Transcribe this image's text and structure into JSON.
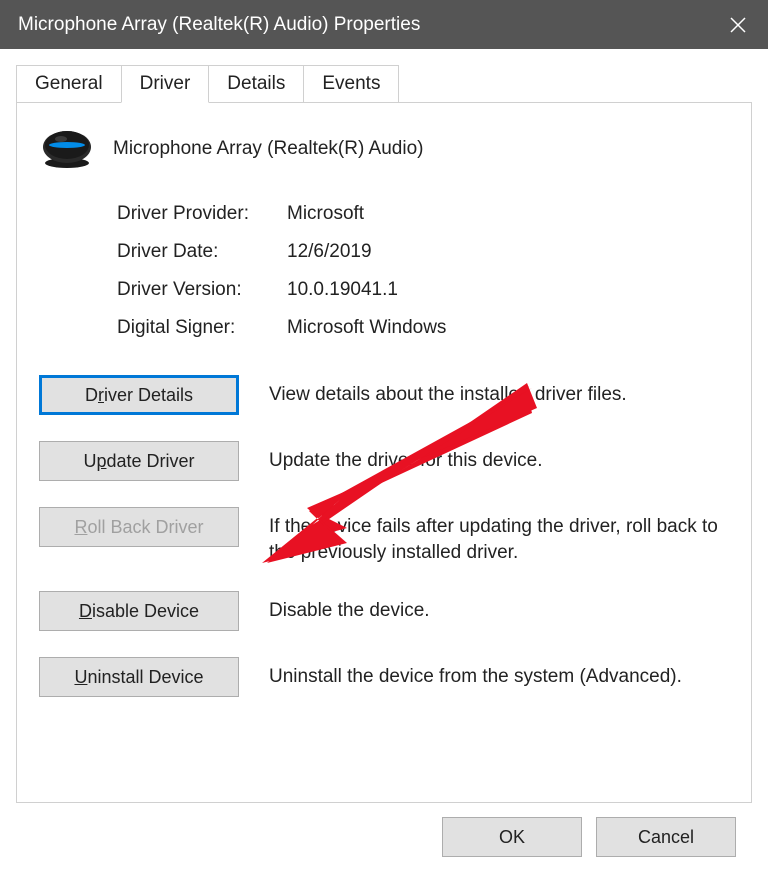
{
  "titlebar": {
    "text": "Microphone Array (Realtek(R) Audio) Properties"
  },
  "tabs": {
    "general": "General",
    "driver": "Driver",
    "details": "Details",
    "events": "Events"
  },
  "device": {
    "name": "Microphone Array (Realtek(R) Audio)"
  },
  "info": {
    "provider_label": "Driver Provider:",
    "provider_value": "Microsoft",
    "date_label": "Driver Date:",
    "date_value": "12/6/2019",
    "version_label": "Driver Version:",
    "version_value": "10.0.19041.1",
    "signer_label": "Digital Signer:",
    "signer_value": "Microsoft Windows"
  },
  "actions": {
    "details_label_pre": "D",
    "details_label_u": "r",
    "details_label_post": "iver Details",
    "details_desc": "View details about the installed driver files.",
    "update_label_pre": "U",
    "update_label_u": "p",
    "update_label_post": "date Driver",
    "update_desc": "Update the driver for this device.",
    "rollback_label_pre": "",
    "rollback_label_u": "R",
    "rollback_label_post": "oll Back Driver",
    "rollback_desc": "If the device fails after updating the driver, roll back to the previously installed driver.",
    "disable_label_pre": "",
    "disable_label_u": "D",
    "disable_label_post": "isable Device",
    "disable_desc": "Disable the device.",
    "uninstall_label_pre": "",
    "uninstall_label_u": "U",
    "uninstall_label_post": "ninstall Device",
    "uninstall_desc": "Uninstall the device from the system (Advanced)."
  },
  "footer": {
    "ok": "OK",
    "cancel": "Cancel"
  }
}
